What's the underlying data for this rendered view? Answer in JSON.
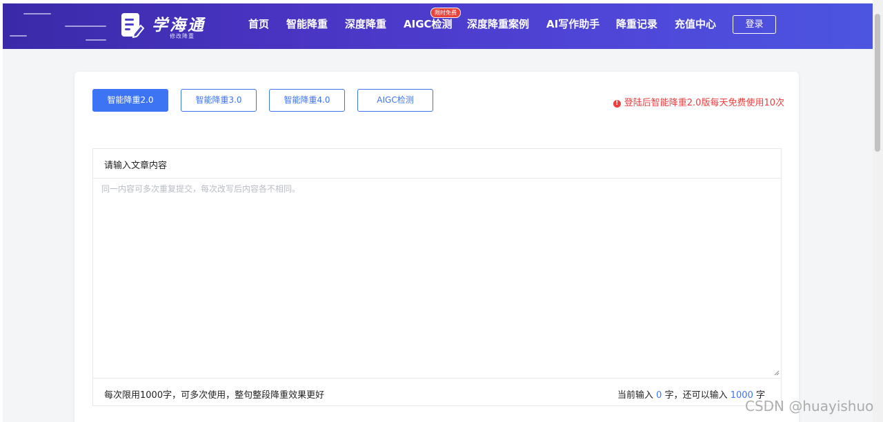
{
  "header": {
    "logo_title": "学海通",
    "logo_subtitle": "修改降重",
    "nav": [
      {
        "label": "首页"
      },
      {
        "label": "智能降重"
      },
      {
        "label": "深度降重"
      },
      {
        "label": "AIGC检测"
      },
      {
        "label": "深度降重案例"
      },
      {
        "label": "AI写作助手"
      },
      {
        "label": "降重记录"
      },
      {
        "label": "充值中心"
      }
    ],
    "aigc_badge": "限时免费",
    "login_label": "登录"
  },
  "modes": {
    "tabs": [
      {
        "label": "智能降重2.0"
      },
      {
        "label": "智能降重3.0"
      },
      {
        "label": "智能降重4.0"
      },
      {
        "label": "AIGC检测"
      }
    ],
    "active_index": 0,
    "notice_icon": "exclamation",
    "notice": "登陆后智能降重2.0版每天免费使用10次"
  },
  "editor": {
    "title": "请输入文章内容",
    "value": "",
    "placeholder": "同一内容可多次重复提交，每次改写后内容各不相同。",
    "footer_left": "每次限用1000字，可多次使用，整句整段降重效果更好",
    "count_prefix": "当前输入",
    "count_current": "0",
    "count_mid": "字，还可以输入",
    "count_remaining": "1000",
    "count_suffix": "字"
  },
  "colors": {
    "accent": "#3c74f4",
    "notice_red": "#f03c3c",
    "badge_red": "#e8423b"
  },
  "watermark": "CSDN @huayishuo"
}
